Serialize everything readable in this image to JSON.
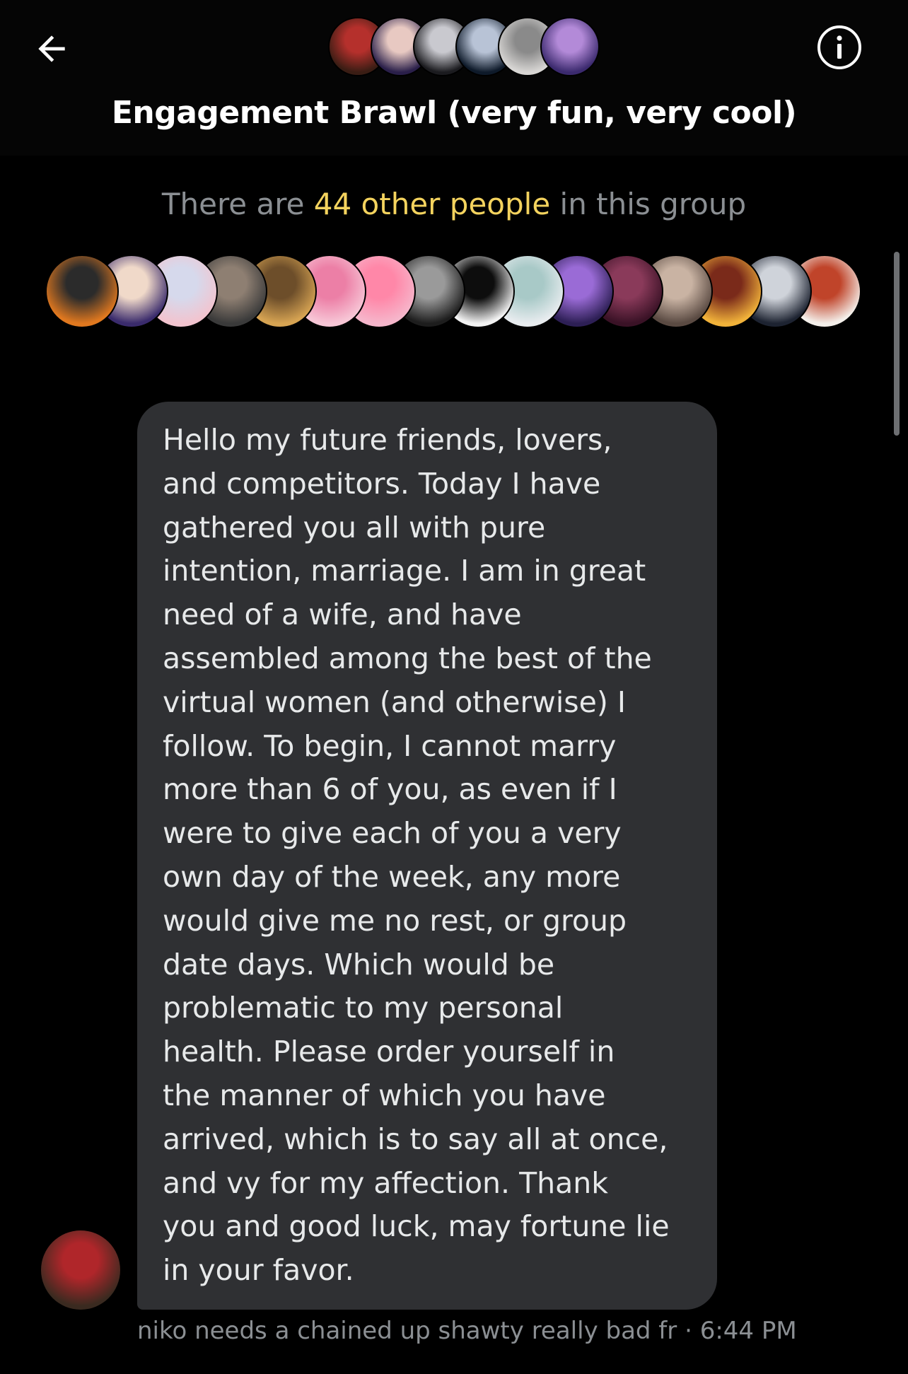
{
  "header": {
    "title": "Engagement Brawl (very fun, very cool)",
    "back_icon": "arrow-left-icon",
    "info_icon": "info-circle-icon",
    "avatars": [
      {
        "colors": [
          "#3a1d14",
          "#b5302c"
        ]
      },
      {
        "colors": [
          "#2a1f4a",
          "#e8c9c2"
        ]
      },
      {
        "colors": [
          "#1b1b1f",
          "#c9c9cf"
        ]
      },
      {
        "colors": [
          "#0e1a2a",
          "#b8c3d6"
        ]
      },
      {
        "colors": [
          "#d8d6d4",
          "#8a8a8a"
        ]
      },
      {
        "colors": [
          "#3b2a6e",
          "#b38ad8"
        ]
      }
    ]
  },
  "members": {
    "prefix": "There are ",
    "highlight": "44 other people",
    "suffix": " in this group",
    "highlight_color": "#f4d35e",
    "avatars": [
      {
        "colors": [
          "#e0781f",
          "#2b2b2b"
        ]
      },
      {
        "colors": [
          "#3a2b6c",
          "#f0d9c9"
        ]
      },
      {
        "colors": [
          "#f2c4cf",
          "#d6d9ec"
        ]
      },
      {
        "colors": [
          "#3a3a3a",
          "#8e7f72"
        ]
      },
      {
        "colors": [
          "#d6a352",
          "#6d4e2a"
        ]
      },
      {
        "colors": [
          "#f7c6d6",
          "#ec7fa6"
        ]
      },
      {
        "colors": [
          "#f6b6cb",
          "#ff87a8"
        ]
      },
      {
        "colors": [
          "#1d1d1d",
          "#9a9a9a"
        ]
      },
      {
        "colors": [
          "#f2f2f2",
          "#0d0d0d"
        ]
      },
      {
        "colors": [
          "#e8ecef",
          "#a8c9c7"
        ]
      },
      {
        "colors": [
          "#2d1f55",
          "#9a6bd6"
        ]
      },
      {
        "colors": [
          "#3a1226",
          "#8a3a5a"
        ]
      },
      {
        "colors": [
          "#5a4a42",
          "#c9b3a3"
        ]
      },
      {
        "colors": [
          "#f1b23a",
          "#7a2a1a"
        ]
      },
      {
        "colors": [
          "#1d2331",
          "#cfd3da"
        ]
      },
      {
        "colors": [
          "#f4efea",
          "#c0442a"
        ]
      }
    ]
  },
  "message": {
    "text": "Hello my future friends, lovers,\nand competitors. Today I have\ngathered you all with pure\nintention, marriage. I am in great\nneed of a wife, and have\nassembled among the best of the\nvirtual women (and otherwise) I\nfollow. To begin, I cannot marry\nmore than 6 of you, as even if I\nwere to give each of you a very\nown day of the week, any more\nwould give me no rest, or group\ndate days. Which would be\nproblematic to my personal\nhealth. Please order yourself in\nthe manner of which you have\narrived, which is to say all at once,\nand vy for my affection. Thank\nyou and good luck, may fortune lie\nin your favor.",
    "sender_name": "niko needs a chained up shawty really bad fr",
    "separator": " · ",
    "time": "6:44 PM",
    "sender_avatar_colors": [
      "#3a2a20",
      "#b0262a"
    ]
  }
}
